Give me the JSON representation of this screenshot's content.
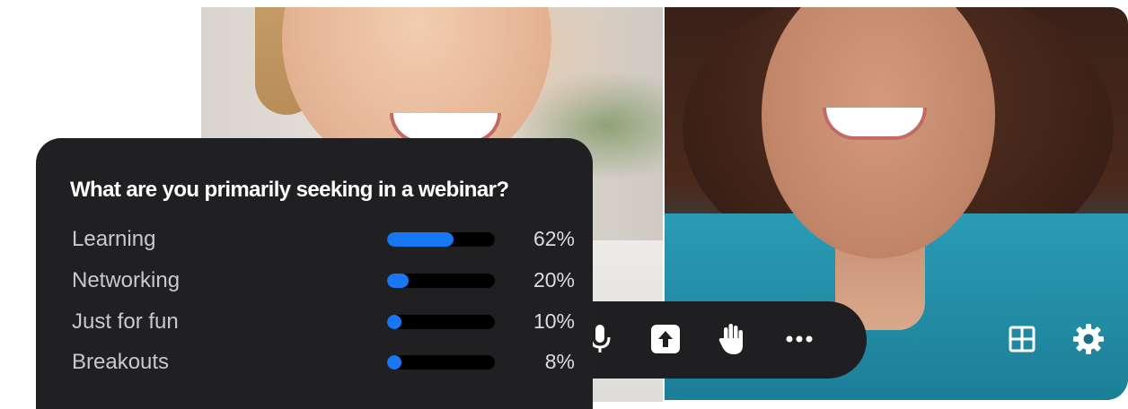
{
  "poll": {
    "question": "What are you primarily seeking in a webinar?",
    "options": [
      {
        "label": "Learning",
        "percent_text": "62%",
        "percent": 62
      },
      {
        "label": "Networking",
        "percent_text": "20%",
        "percent": 20
      },
      {
        "label": "Just for fun",
        "percent_text": "10%",
        "percent": 10
      },
      {
        "label": "Breakouts",
        "percent_text": "8%",
        "percent": 8
      }
    ],
    "bar_color": "#1877f2"
  },
  "controls": {
    "icons": [
      "microphone-icon",
      "share-screen-icon",
      "raise-hand-icon",
      "more-icon"
    ],
    "corner_icons": [
      "grid-view-icon",
      "settings-gear-icon"
    ]
  },
  "colors": {
    "panel_bg": "#202022",
    "control_bar_bg": "#1f1f21"
  }
}
